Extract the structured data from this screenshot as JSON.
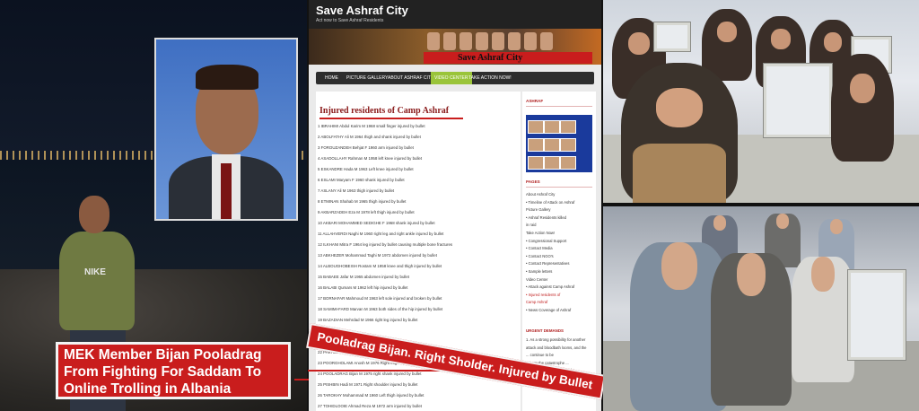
{
  "left_panel": {
    "caption_lines": [
      "MEK Member Bijan Pooladrag",
      "From Fighting For Saddam To",
      "Online Trolling in Albania"
    ],
    "shirt_text": "NIKE"
  },
  "website": {
    "title": "Save Ashraf City",
    "tagline": "Act now to Save Ashraf Residents",
    "banner_text": "Save Ashraf City",
    "nav": [
      "HOME",
      "PICTURE GALLERY",
      "ABOUT ASHRAF CITY",
      "VIDEO CENTER",
      "TAKE ACTION NOW!"
    ],
    "nav_active_index": 3,
    "content_title": "Injured residents of Camp Ashraf",
    "rows": [
      "1  IBRAHIMI Abdul Karim M 1968 small finger injured by bullet",
      "2  ABOLFATHY Ali M 1964 thigh and shank injured by bullet",
      "3  FOROUZANDEH Behjat F 1960 arm injured by bullet",
      "4  ASADOLLAHY Rahman M 1958 left knee injured by bullet",
      "5  ESKANDRE Hada M 1963 Left knee injured by bullet",
      "6  ESLAMI Maryam F 1960 shank injured by bullet",
      "7  ASLANY Ali M 1963 thigh injured by bullet",
      "8  ETMINAN Shahab M 1965 thigh injured by bullet",
      "9  AKBARZADEH Eza M 1978 left thigh injured by bullet",
      "10  AKBARI MOHAMMED SEDIGHE F 1968 shank injured by bullet",
      "11  ALLAHVERDI Naghi M 1960 right leg and right ankle injured by bullet",
      "12  ILKHANI Mitra F 1964 leg injured by bullet causing multiple bone fractures",
      "13  ABKHEZER Mohammad Taghi M 1972 abdomen injured by bullet",
      "14  ALBOUGHOBEISH Rostam M 1958 knee and thigh injured by bullet",
      "15  BABAEE Jafar M 1965 abdomen injured by bullet",
      "16  BALABI Qumars M 1962 left hip injured by bullet",
      "17  BORNAFAR Mahmoud M 1963 left sole injured and broken by bullet",
      "18  SAMIMI-FARD Marvan M 1963 both sides of the hip injured by bullet",
      "19  BAZADIAN Mehrdad M 1966 right leg injured by bullet",
      "20  ...",
      "21  ...",
      "22  PAKI Jafar M 1966 ...",
      "23  POORGHOLAMI Anosh M 1976 Right thigh injured by ...",
      "24  POOLADRAG Bijan M 1975 right shank injured by bullet",
      "25  PISHBIN Hadi M 1971 Right shoulder injured by bullet",
      "26  TAROKHY Mohammad M 1960 Left thigh injured by bullet",
      "27  TOHIDLOOIE Ahmad Reza M 1972 arm injured by bullet"
    ],
    "sidebar": {
      "ashraf_heading": "ASHRAF",
      "pages_heading": "PAGES",
      "items": [
        {
          "text": "About Ashraf City",
          "red": false
        },
        {
          "text": " • Timeline of Attack on Ashraf",
          "red": false
        },
        {
          "text": "Picture Gallery",
          "red": false
        },
        {
          "text": " • Ashraf Residents killed",
          "red": false
        },
        {
          "text": "   in raid",
          "red": false
        },
        {
          "text": "Take Action Now!",
          "red": false
        },
        {
          "text": " • Congressional Support",
          "red": false
        },
        {
          "text": " • Contact Media",
          "red": false
        },
        {
          "text": " • Contact NGO's",
          "red": false
        },
        {
          "text": " • Contact Representatives",
          "red": false
        },
        {
          "text": " • Sample letters",
          "red": false
        },
        {
          "text": "Video Center",
          "red": false
        },
        {
          "text": " • Attack against Camp Ashraf",
          "red": false
        },
        {
          "text": " • Injured residents of",
          "red": true
        },
        {
          "text": "   Camp Ashraf",
          "red": true
        },
        {
          "text": " • News Coverage of Ashraf",
          "red": false
        }
      ],
      "urgent_heading": "URGENT DEMANDS",
      "urgent_lines": [
        "1. As a strong possibility for another",
        "attack and bloodbath looms, and the",
        "... continue to be",
        "prior to the catastrophe ...",
        "prevent another attack on the",
        "residents.",
        "2. A UNAMI monitoring team to be"
      ]
    }
  },
  "ribbon_text": "Pooladrag Bijan. Right Sholder. Injured by Bullet",
  "colors": {
    "accent_red": "#c91d1d",
    "nav_active": "#9ac43a",
    "site_header": "#222222"
  }
}
